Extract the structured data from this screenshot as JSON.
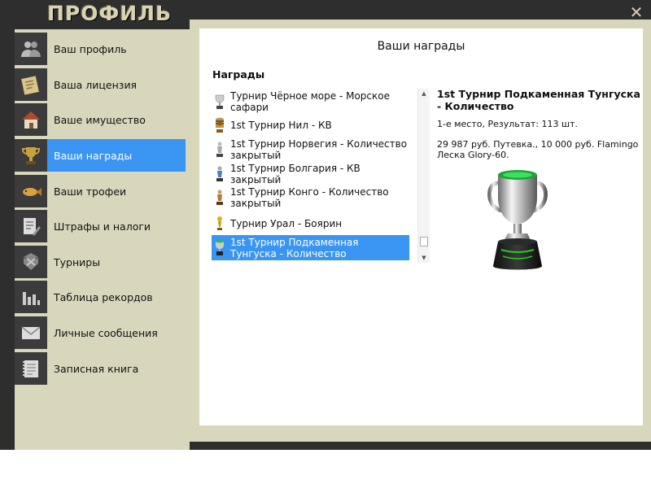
{
  "window": {
    "title": "ПРОФИЛЬ",
    "close_label": "×"
  },
  "sidebar": {
    "items": [
      {
        "label": "Ваш профиль",
        "icon": "users-icon",
        "active": false
      },
      {
        "label": "Ваша лицензия",
        "icon": "license-icon",
        "active": false
      },
      {
        "label": "Ваше имущество",
        "icon": "house-icon",
        "active": false
      },
      {
        "label": "Ваши награды",
        "icon": "trophy-icon",
        "active": true
      },
      {
        "label": "Ваши трофеи",
        "icon": "fish-icon",
        "active": false
      },
      {
        "label": "Штрафы и налоги",
        "icon": "document-pen-icon",
        "active": false
      },
      {
        "label": "Турниры",
        "icon": "tournament-icon",
        "active": false
      },
      {
        "label": "Таблица рекордов",
        "icon": "bar-chart-icon",
        "active": false
      },
      {
        "label": "Личные сообщения",
        "icon": "envelope-icon",
        "active": false
      },
      {
        "label": "Записная книга",
        "icon": "notebook-icon",
        "active": false
      }
    ]
  },
  "panel": {
    "title": "Ваши награды",
    "section_title": "Награды",
    "awards": [
      {
        "label": "Турнир Чёрное море - Морское сафари",
        "icon": "silver-cup-icon",
        "selected": false
      },
      {
        "label": "1st Турнир Нил - КВ",
        "icon": "pharaoh-award-icon",
        "selected": false
      },
      {
        "label": "1st Турнир Норвегия - Количество закрытый",
        "icon": "silver-statue-icon",
        "selected": false
      },
      {
        "label": "1st Турнир Болгария - КВ закрытый",
        "icon": "blue-statue-icon",
        "selected": false
      },
      {
        "label": "1st Турнир Конго - Количество закрытый",
        "icon": "bronze-statue-icon",
        "selected": false
      },
      {
        "label": "Турнир Урал - Боярин",
        "icon": "gold-figure-icon",
        "selected": false
      },
      {
        "label": "1st Турнир Подкаменная Тунгуска - Количество",
        "icon": "green-cup-icon",
        "selected": true
      }
    ],
    "detail": {
      "title": "1st Турнир Подкаменная Тунгуска - Количество",
      "result": "1-е место, Результат: 113 шт.",
      "prize": "29 987 руб. Путевка., 10 000 руб. Flamingo Леска Glory-60.",
      "trophy_icon": "trophy-cup-icon"
    }
  },
  "colors": {
    "accent": "#3a95f2",
    "frame": "#2e2e2e",
    "sidebar_bg": "#d8d7bb",
    "title": "#d9d3b2"
  }
}
